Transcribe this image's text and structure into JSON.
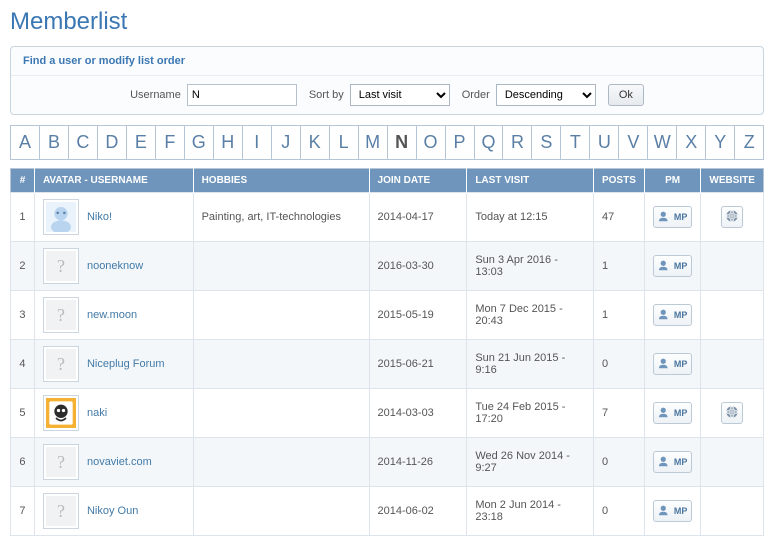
{
  "page_title": "Memberlist",
  "filter": {
    "heading": "Find a user or modify list order",
    "username_label": "Username",
    "username_value": "N",
    "sortby_label": "Sort by",
    "sortby_value": "Last visit",
    "order_label": "Order",
    "order_value": "Descending",
    "ok_label": "Ok"
  },
  "alpha": [
    "A",
    "B",
    "C",
    "D",
    "E",
    "F",
    "G",
    "H",
    "I",
    "J",
    "K",
    "L",
    "M",
    "N",
    "O",
    "P",
    "Q",
    "R",
    "S",
    "T",
    "U",
    "V",
    "W",
    "X",
    "Y",
    "Z"
  ],
  "alpha_active": "N",
  "headers": {
    "num": "#",
    "avatar": "AVATAR - USERNAME",
    "hobbies": "HOBBIES",
    "join": "JOIN DATE",
    "visit": "LAST VISIT",
    "posts": "POSTS",
    "pm": "PM",
    "website": "WEBSITE"
  },
  "pm_label": "MP",
  "rows": [
    {
      "n": "1",
      "username": "Niko!",
      "hobbies": "Painting, art, IT-technologies",
      "join": "2014-04-17",
      "visit": "Today at 12:15",
      "posts": "47",
      "avatar": "niko",
      "website": true
    },
    {
      "n": "2",
      "username": "nooneknow",
      "hobbies": "",
      "join": "2016-03-30",
      "visit": "Sun 3 Apr 2016 - 13:03",
      "posts": "1",
      "avatar": "",
      "website": false
    },
    {
      "n": "3",
      "username": "new.moon",
      "hobbies": "",
      "join": "2015-05-19",
      "visit": "Mon 7 Dec 2015 - 20:43",
      "posts": "1",
      "avatar": "",
      "website": false
    },
    {
      "n": "4",
      "username": "Niceplug Forum",
      "hobbies": "",
      "join": "2015-06-21",
      "visit": "Sun 21 Jun 2015 - 9:16",
      "posts": "0",
      "avatar": "",
      "website": false
    },
    {
      "n": "5",
      "username": "naki",
      "hobbies": "",
      "join": "2014-03-03",
      "visit": "Tue 24 Feb 2015 - 17:20",
      "posts": "7",
      "avatar": "naki",
      "website": true
    },
    {
      "n": "6",
      "username": "novaviet.com",
      "hobbies": "",
      "join": "2014-11-26",
      "visit": "Wed 26 Nov 2014 - 9:27",
      "posts": "0",
      "avatar": "",
      "website": false
    },
    {
      "n": "7",
      "username": "Nikoy Oun",
      "hobbies": "",
      "join": "2014-06-02",
      "visit": "Mon 2 Jun 2014 - 23:18",
      "posts": "0",
      "avatar": "",
      "website": false
    }
  ]
}
